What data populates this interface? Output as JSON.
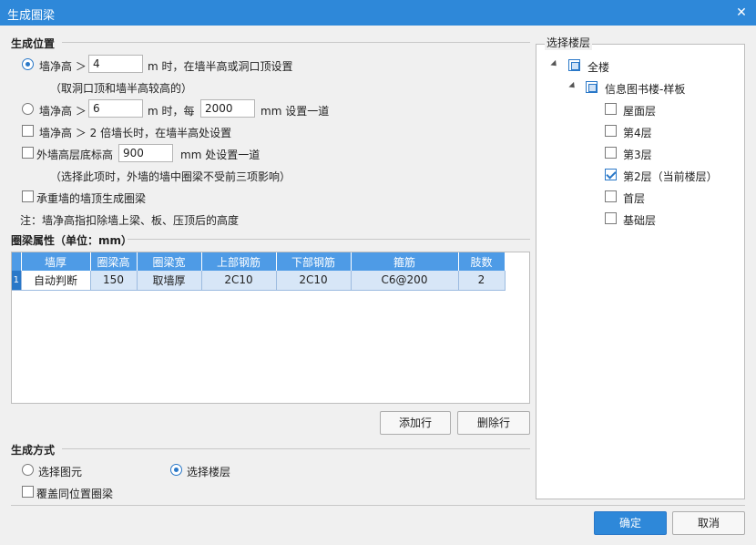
{
  "window": {
    "title": "生成圈梁",
    "close_glyph": "✕"
  },
  "position_section": {
    "title": "生成位置",
    "opt1": {
      "label": "墙净高 ＞",
      "value": "4",
      "suffix": "m 时，在墙半高或洞口顶设置",
      "note": "（取洞口顶和墙半高较高的）",
      "checked": true
    },
    "opt2": {
      "label": "墙净高 ＞",
      "value1": "6",
      "mid": "m 时，每",
      "value2": "2000",
      "suffix": "mm 设置一道",
      "checked": false
    },
    "opt3": {
      "label": "墙净高 ＞ 2 倍墙长时，在墙半高处设置",
      "checked": false
    },
    "opt4": {
      "label": "外墙高层底标高",
      "value": "900",
      "suffix": "mm 处设置一道",
      "note": "（选择此项时，外墙的墙中圈梁不受前三项影响）",
      "checked": false
    },
    "opt5": {
      "label": "承重墙的墙顶生成圈梁",
      "checked": false
    },
    "footnote": "注：墙净高指扣除墙上梁、板、压顶后的高度"
  },
  "props_section": {
    "title": "圈梁属性（单位：mm）",
    "columns": [
      "墙厚",
      "圈梁高",
      "圈梁宽",
      "上部钢筋",
      "下部钢筋",
      "箍筋",
      "肢数"
    ],
    "rows": [
      {
        "index": "1",
        "cells": [
          "自动判断",
          "150",
          "取墙厚",
          "2C10",
          "2C10",
          "C6@200",
          "2"
        ]
      }
    ],
    "add_row": "添加行",
    "delete_row": "删除行"
  },
  "method_section": {
    "title": "生成方式",
    "opt_select_element": "选择图元",
    "opt_select_floor": "选择楼层",
    "selected": "选择楼层",
    "overwrite": "覆盖同位置圈梁"
  },
  "floor_section": {
    "title": "选择楼层",
    "root": "全楼",
    "building": "信息图书楼-样板",
    "floors": [
      {
        "label": "屋面层",
        "checked": false
      },
      {
        "label": "第4层",
        "checked": false
      },
      {
        "label": "第3层",
        "checked": false
      },
      {
        "label": "第2层（当前楼层）",
        "checked": true
      },
      {
        "label": "首层",
        "checked": false
      },
      {
        "label": "基础层",
        "checked": false
      }
    ]
  },
  "footer": {
    "ok": "确定",
    "cancel": "取消"
  },
  "colors": {
    "accent": "#2e88d9",
    "header": "#4e9be6",
    "row": "#d7e6f7"
  }
}
